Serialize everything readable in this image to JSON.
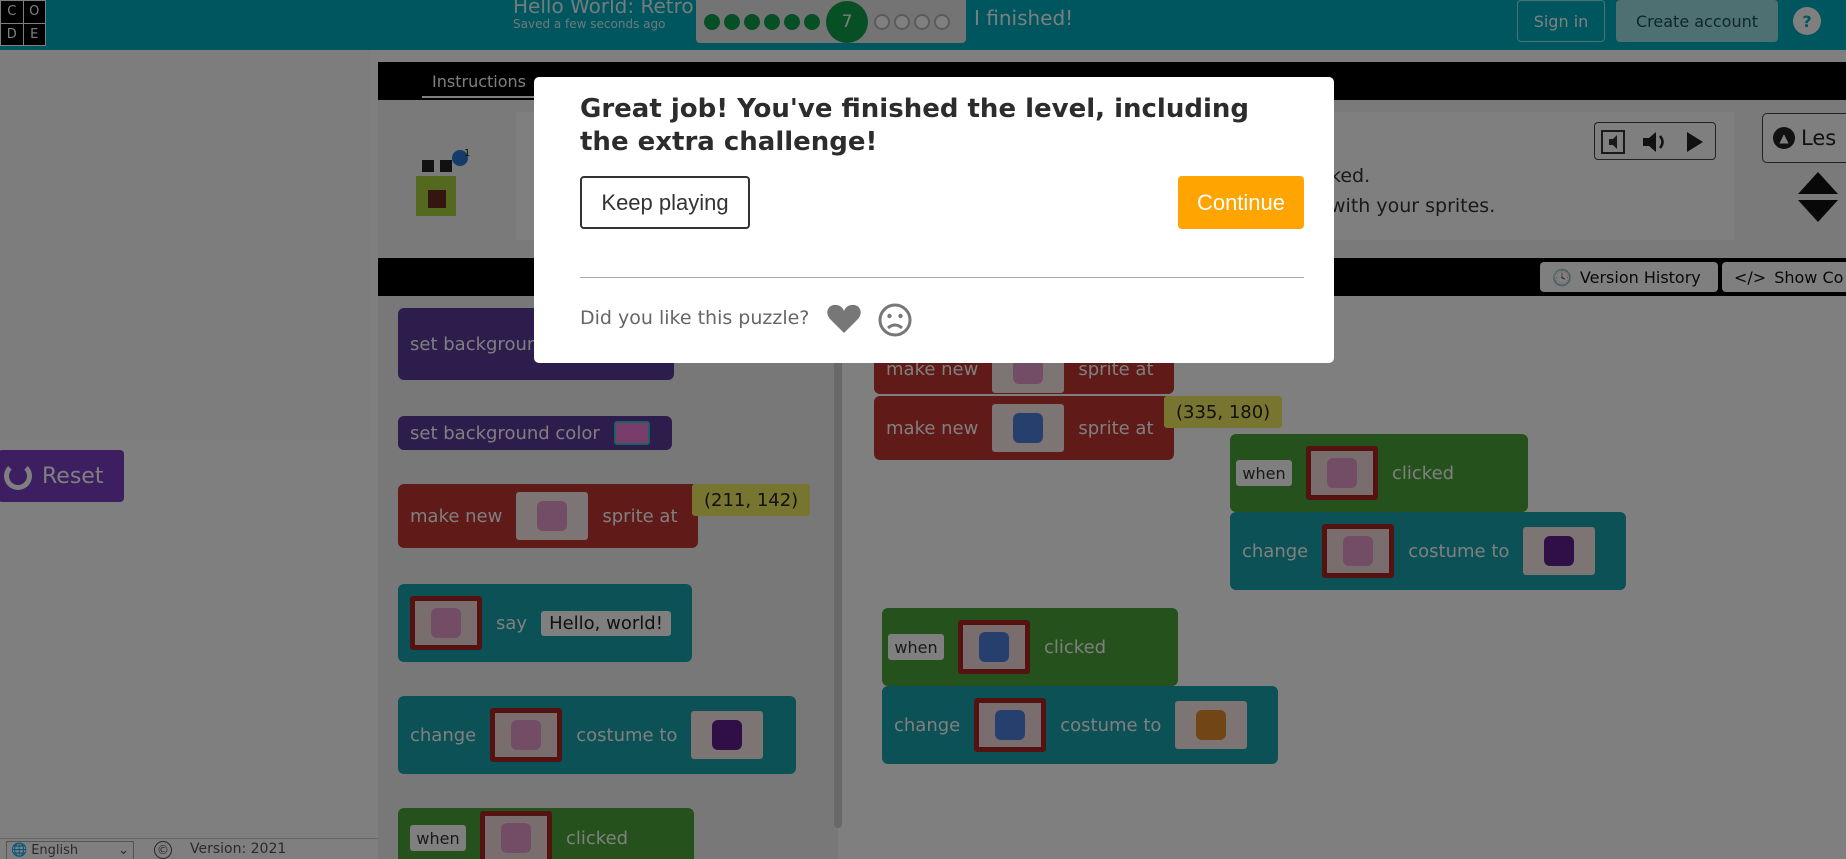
{
  "header": {
    "logo_letters": [
      "C",
      "O",
      "D",
      "E"
    ],
    "title": "Hello World: Retro",
    "save_status": "Saved a few seconds ago",
    "progress": {
      "completed": 6,
      "current": "7",
      "remaining": 4
    },
    "finished_label": "I finished!",
    "sign_in": "Sign in",
    "create_account": "Create account",
    "help": "?"
  },
  "viz": {
    "reset_label": "Reset"
  },
  "footer": {
    "language": "English",
    "copyright_icon": "©",
    "version": "Version: 2021"
  },
  "instructions": {
    "tab_label": "Instructions",
    "line1": "ked.",
    "line2": "with your sprites.",
    "lesson_button": "Les"
  },
  "workspace_header": {
    "version_history": "Version History",
    "show_code": "Show Co"
  },
  "toolbox": {
    "set_background": "set backgroun",
    "set_background_color": "set background color",
    "make_new": "make new",
    "sprite_at": "sprite at",
    "coord1": "(211, 142)",
    "say": "say",
    "say_text": "Hello, world!",
    "change": "change",
    "costume_to": "costume to",
    "when": "when",
    "clicked": "clicked"
  },
  "workspace": {
    "make_new_partial": "make new",
    "sprite_at_partial": "sprite at",
    "make_new": "make new",
    "sprite_at": "sprite at",
    "coord": "(335, 180)",
    "when": "when",
    "clicked": "clicked",
    "change": "change",
    "costume_to": "costume to"
  },
  "dialog": {
    "title": "Great job! You've finished the level, including the extra challenge!",
    "keep_playing": "Keep playing",
    "continue": "Continue",
    "like_question": "Did you like this puzzle?"
  },
  "colors": {
    "header_bg": "#00adbc",
    "continue_bg": "#ffa400",
    "progress_done": "#0e9e4a"
  }
}
